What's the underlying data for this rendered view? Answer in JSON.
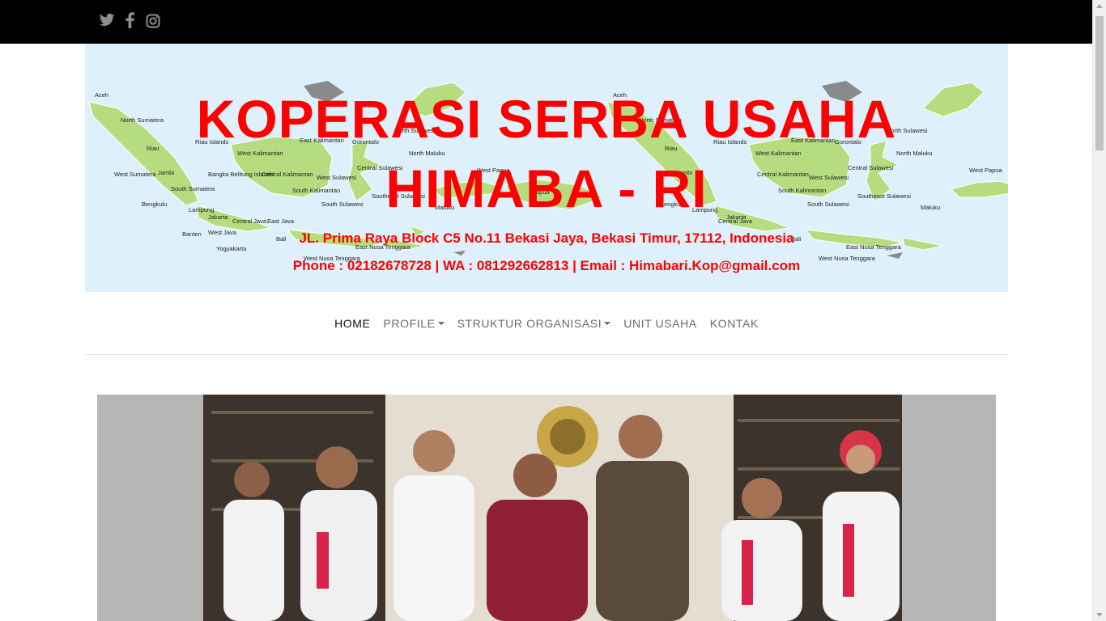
{
  "topbar": {
    "social_icons": [
      "twitter-icon",
      "facebook-icon",
      "instagram-icon"
    ]
  },
  "banner": {
    "title": "KOPERASI SERBA USAHA HIMABA - RI",
    "address": "JL. Prima Raya Block C5 No.11 Bekasi Jaya, Bekasi Timur, 17112, Indonesia",
    "contact": "Phone : 02182678728 | WA : 081292662813 | Email : Himabari.Kop@gmail.com",
    "map_labels": [
      "Aceh",
      "North Sumatera",
      "Riau",
      "West Sumatera",
      "Jambi",
      "South Sumatera",
      "Bengkulu",
      "Lampung",
      "Banten",
      "West Java",
      "Jakarta",
      "Central Java",
      "East Java",
      "Yogyakarta",
      "Riau Islands",
      "Bangka Belitung Islands",
      "West Kalimantan",
      "Central Kalimantan",
      "South Kalimantan",
      "East Kalimantan",
      "Gorontalo",
      "North Sulawesi",
      "North Maluku",
      "West Sulawesi",
      "Central Sulawesi",
      "South Sulawesi",
      "Southeast Sulawesi",
      "Maluku",
      "West Papua",
      "Papua",
      "Bali",
      "West Nusa Tenggara",
      "East Nusa Tenggara"
    ]
  },
  "nav": {
    "items": [
      {
        "label": "HOME",
        "dropdown": false
      },
      {
        "label": "PROFILE",
        "dropdown": true
      },
      {
        "label": "STRUKTUR ORGANISASI",
        "dropdown": true
      },
      {
        "label": "UNIT USAHA",
        "dropdown": false
      },
      {
        "label": "KONTAK",
        "dropdown": false
      }
    ]
  },
  "colors": {
    "accent": "#ff0000",
    "topbar": "#000000",
    "map_land": "#b5dd7f",
    "map_sea": "#def0fb"
  }
}
